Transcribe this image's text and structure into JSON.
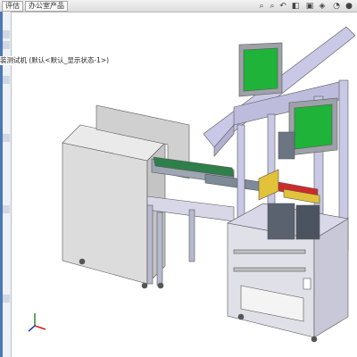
{
  "topbar": {
    "tabs": [
      {
        "label": "评估"
      },
      {
        "label": "办公室产品"
      }
    ]
  },
  "view_toolbar": {
    "icons": [
      "zoom-fit-icon",
      "zoom-area-icon",
      "previous-view-icon",
      "section-view-icon",
      "view-orientation-icon",
      "display-style-icon",
      "hide-show-icon",
      "appearance-icon"
    ]
  },
  "feature_tree": {
    "item_label": "装测试机  (默认<默认_显示状态-1>)"
  },
  "colors": {
    "frame_blue": "#b9bcd6",
    "panel_gray": "#d9d9d9",
    "screen_green": "#1fb33a",
    "accent_yellow": "#e2c23a",
    "accent_red": "#cc2b2b"
  }
}
